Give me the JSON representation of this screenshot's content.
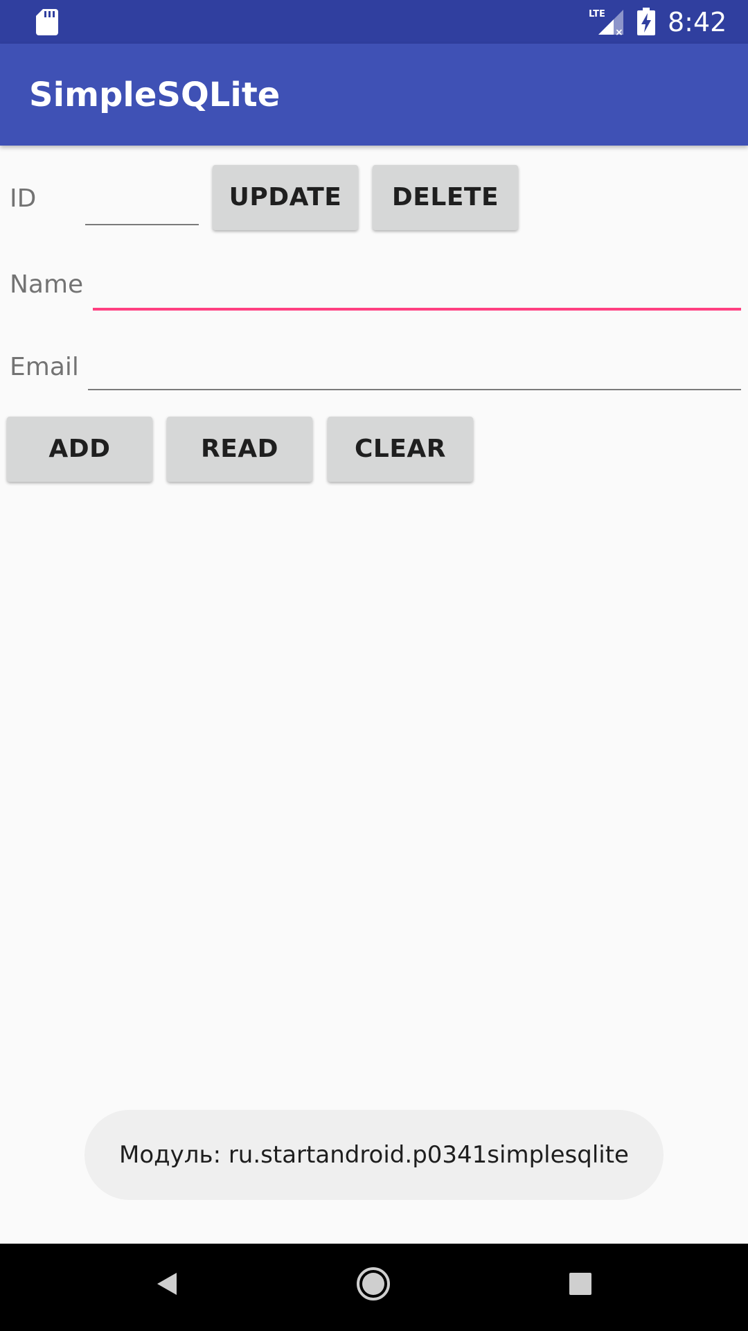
{
  "status_bar": {
    "time": "8:42",
    "network": "LTE",
    "icons": [
      "sd-card-icon",
      "signal-lte-icon",
      "battery-charging-icon"
    ]
  },
  "app_bar": {
    "title": "SimpleSQLite"
  },
  "form": {
    "id_label": "ID",
    "name_label": "Name",
    "email_label": "Email",
    "id_value": "",
    "name_value": "",
    "email_value": ""
  },
  "buttons": {
    "update": "UPDATE",
    "delete": "DELETE",
    "add": "ADD",
    "read": "READ",
    "clear": "CLEAR"
  },
  "toast": {
    "message": "Модуль: ru.startandroid.p0341simplesqlite"
  },
  "nav_bar": {
    "icons": [
      "back-icon",
      "home-icon",
      "recents-icon"
    ]
  },
  "colors": {
    "status_bar": "#303f9f",
    "app_bar": "#3f51b5",
    "accent": "#ff4081",
    "button": "#d6d7d7",
    "background": "#fafafa"
  }
}
